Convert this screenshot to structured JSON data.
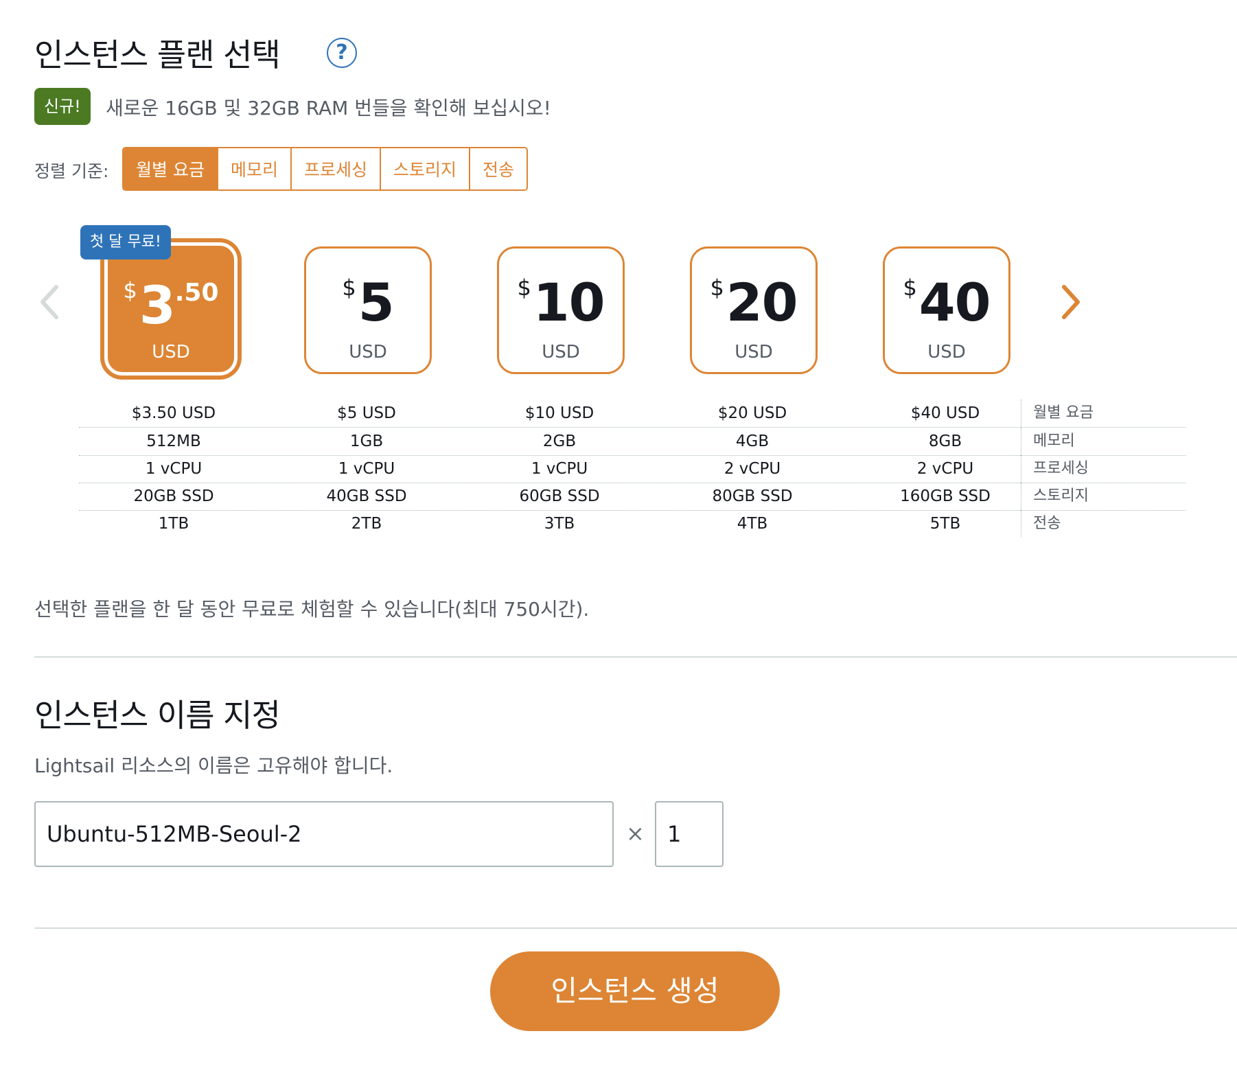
{
  "plan_section": {
    "title": "인스턴스 플랜 선택",
    "help_icon_glyph": "?",
    "new_badge": "신규!",
    "promo_text": "새로운 16GB 및 32GB RAM 번들을 확인해 보십시오!",
    "sort_label": "정렬 기준:",
    "sort_options": [
      "월별 요금",
      "메모리",
      "프로세싱",
      "스토리지",
      "전송"
    ],
    "selected_sort": "월별 요금",
    "prev_icon": "chevron-left-icon",
    "next_icon": "chevron-right-icon",
    "free_badge": "첫 달 무료!",
    "plans": [
      {
        "dollar": "$",
        "amount": "3",
        "cents": ".50",
        "currency": "USD",
        "selected": true
      },
      {
        "dollar": "$",
        "amount": "5",
        "cents": "",
        "currency": "USD",
        "selected": false
      },
      {
        "dollar": "$",
        "amount": "10",
        "cents": "",
        "currency": "USD",
        "selected": false
      },
      {
        "dollar": "$",
        "amount": "20",
        "cents": "",
        "currency": "USD",
        "selected": false
      },
      {
        "dollar": "$",
        "amount": "40",
        "cents": "",
        "currency": "USD",
        "selected": false
      }
    ],
    "spec_rows": [
      {
        "label": "월별 요금",
        "values": [
          "$3.50 USD",
          "$5 USD",
          "$10 USD",
          "$20 USD",
          "$40 USD"
        ]
      },
      {
        "label": "메모리",
        "values": [
          "512MB",
          "1GB",
          "2GB",
          "4GB",
          "8GB"
        ]
      },
      {
        "label": "프로세싱",
        "values": [
          "1 vCPU",
          "1 vCPU",
          "1 vCPU",
          "2 vCPU",
          "2 vCPU"
        ]
      },
      {
        "label": "스토리지",
        "values": [
          "20GB SSD",
          "40GB SSD",
          "60GB SSD",
          "80GB SSD",
          "160GB SSD"
        ]
      },
      {
        "label": "전송",
        "values": [
          "1TB",
          "2TB",
          "3TB",
          "4TB",
          "5TB"
        ]
      }
    ],
    "trial_note": "선택한 플랜을 한 달 동안 무료로 체험할 수 있습니다(최대 750시간)."
  },
  "name_section": {
    "title": "인스턴스 이름 지정",
    "subtitle": "Lightsail 리소스의 이름은 고유해야 합니다.",
    "instance_name": "Ubuntu-512MB-Seoul-2",
    "times_glyph": "×",
    "count": "1"
  },
  "create_button": "인스턴스 생성",
  "colors": {
    "accent": "#dd8534",
    "new_badge": "#4b7a23",
    "free_badge": "#2e73b8",
    "text": "#16191f",
    "muted": "#545b64"
  }
}
